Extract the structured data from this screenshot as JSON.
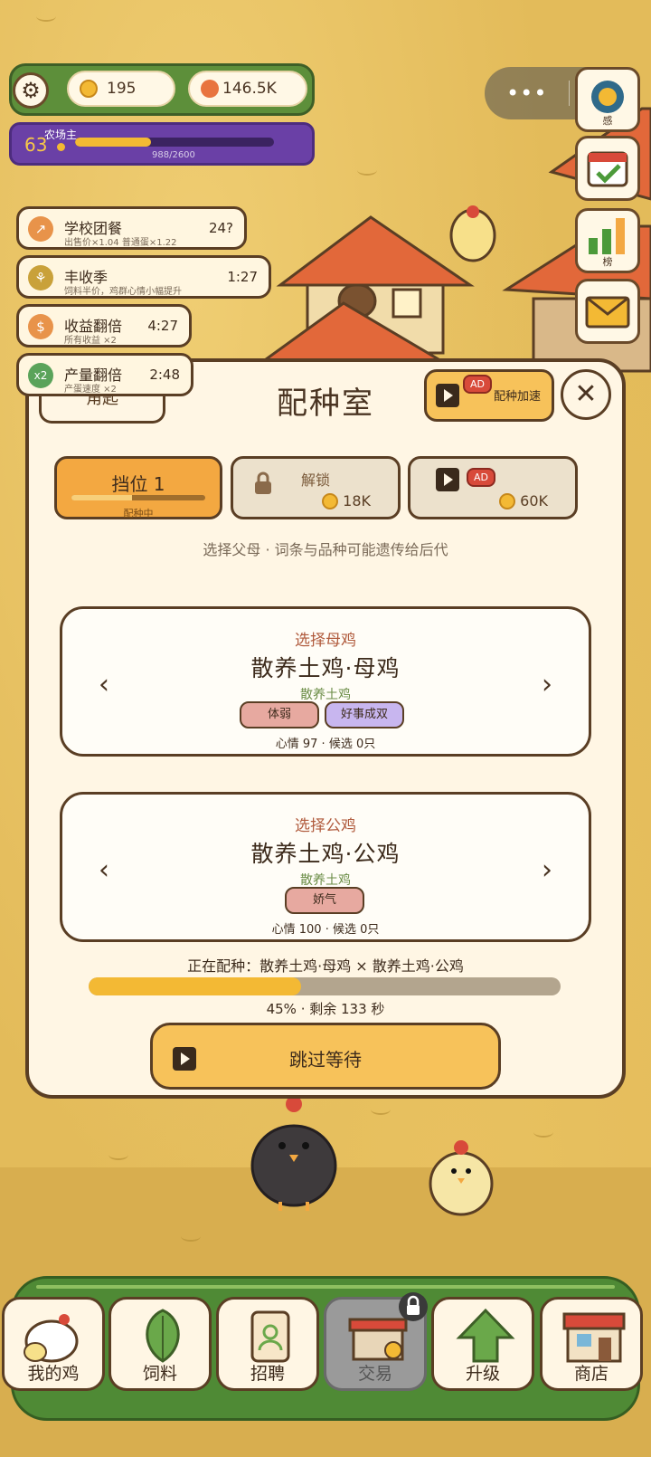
{
  "hud": {
    "coins": "195",
    "gems": "146.5K",
    "level": "63",
    "title": "农场主",
    "xp_text": "988/2600",
    "xp_progress": 0.38
  },
  "side_buttons": [
    {
      "icon": "achievement-icon",
      "label": "感"
    },
    {
      "icon": "calendar-check-icon",
      "label": ""
    },
    {
      "icon": "leaderboard-icon",
      "label": "榜"
    },
    {
      "icon": "mail-icon",
      "label": ""
    }
  ],
  "buffs": [
    {
      "name": "学校团餐",
      "desc": "出售价×1.04 普通蛋×1.22",
      "time": "24?",
      "icon": "↗",
      "color": "#e8934a"
    },
    {
      "name": "丰收季",
      "desc": "饲料半价，鸡群心情小幅提升",
      "time": "1:27",
      "icon": "⚘",
      "color": "#c9a13a"
    },
    {
      "name": "收益翻倍",
      "desc": "所有收益 ×2",
      "time": "4:27",
      "icon": "$",
      "color": "#e8934a"
    },
    {
      "name": "产量翻倍",
      "desc": "产蛋速度 ×2",
      "time": "2:48",
      "icon": "x2",
      "color": "#5aa35a"
    }
  ],
  "panel": {
    "back_tab": "角匙",
    "title": "配种室",
    "speed_label": "配种加速",
    "ad": "AD",
    "close": "✕",
    "slots": [
      {
        "label": "挡位 1",
        "sub": "配种中",
        "progress": 0.45
      },
      {
        "label": "解锁",
        "price": "18K"
      },
      {
        "ad": "AD",
        "price": "60K"
      }
    ],
    "hint": "选择父母 · 词条与品种可能遗传给后代",
    "hen": {
      "head": "选择母鸡",
      "name": "散养土鸡·母鸡",
      "breed": "散养土鸡",
      "traits": [
        "体弱",
        "好事成双"
      ],
      "stat": "心情 97 · 候选 0只"
    },
    "rooster": {
      "head": "选择公鸡",
      "name": "散养土鸡·公鸡",
      "breed": "散养土鸡",
      "traits": [
        "娇气"
      ],
      "stat": "心情 100 · 候选 0只"
    },
    "arrow_left": "‹",
    "arrow_right": "›",
    "breeding_text": "正在配种：散养土鸡·母鸡 × 散养土鸡·公鸡",
    "breeding_progress": 0.45,
    "progress_text": "45% · 剩余 133 秒",
    "skip_label": "跳过等待"
  },
  "nav": [
    {
      "label": "我的鸡",
      "icon": "chicken-icon"
    },
    {
      "label": "饲料",
      "icon": "leaf-icon"
    },
    {
      "label": "招聘",
      "icon": "recruit-badge-icon"
    },
    {
      "label": "交易",
      "icon": "market-stall-icon",
      "locked": true
    },
    {
      "label": "升级",
      "icon": "up-arrow-icon"
    },
    {
      "label": "商店",
      "icon": "shop-icon"
    }
  ],
  "colors": {
    "accent": "#f3b934",
    "panel_border": "#5a3e24",
    "hud_green": "#5d8f3a",
    "level_purple": "#6a40a6"
  }
}
